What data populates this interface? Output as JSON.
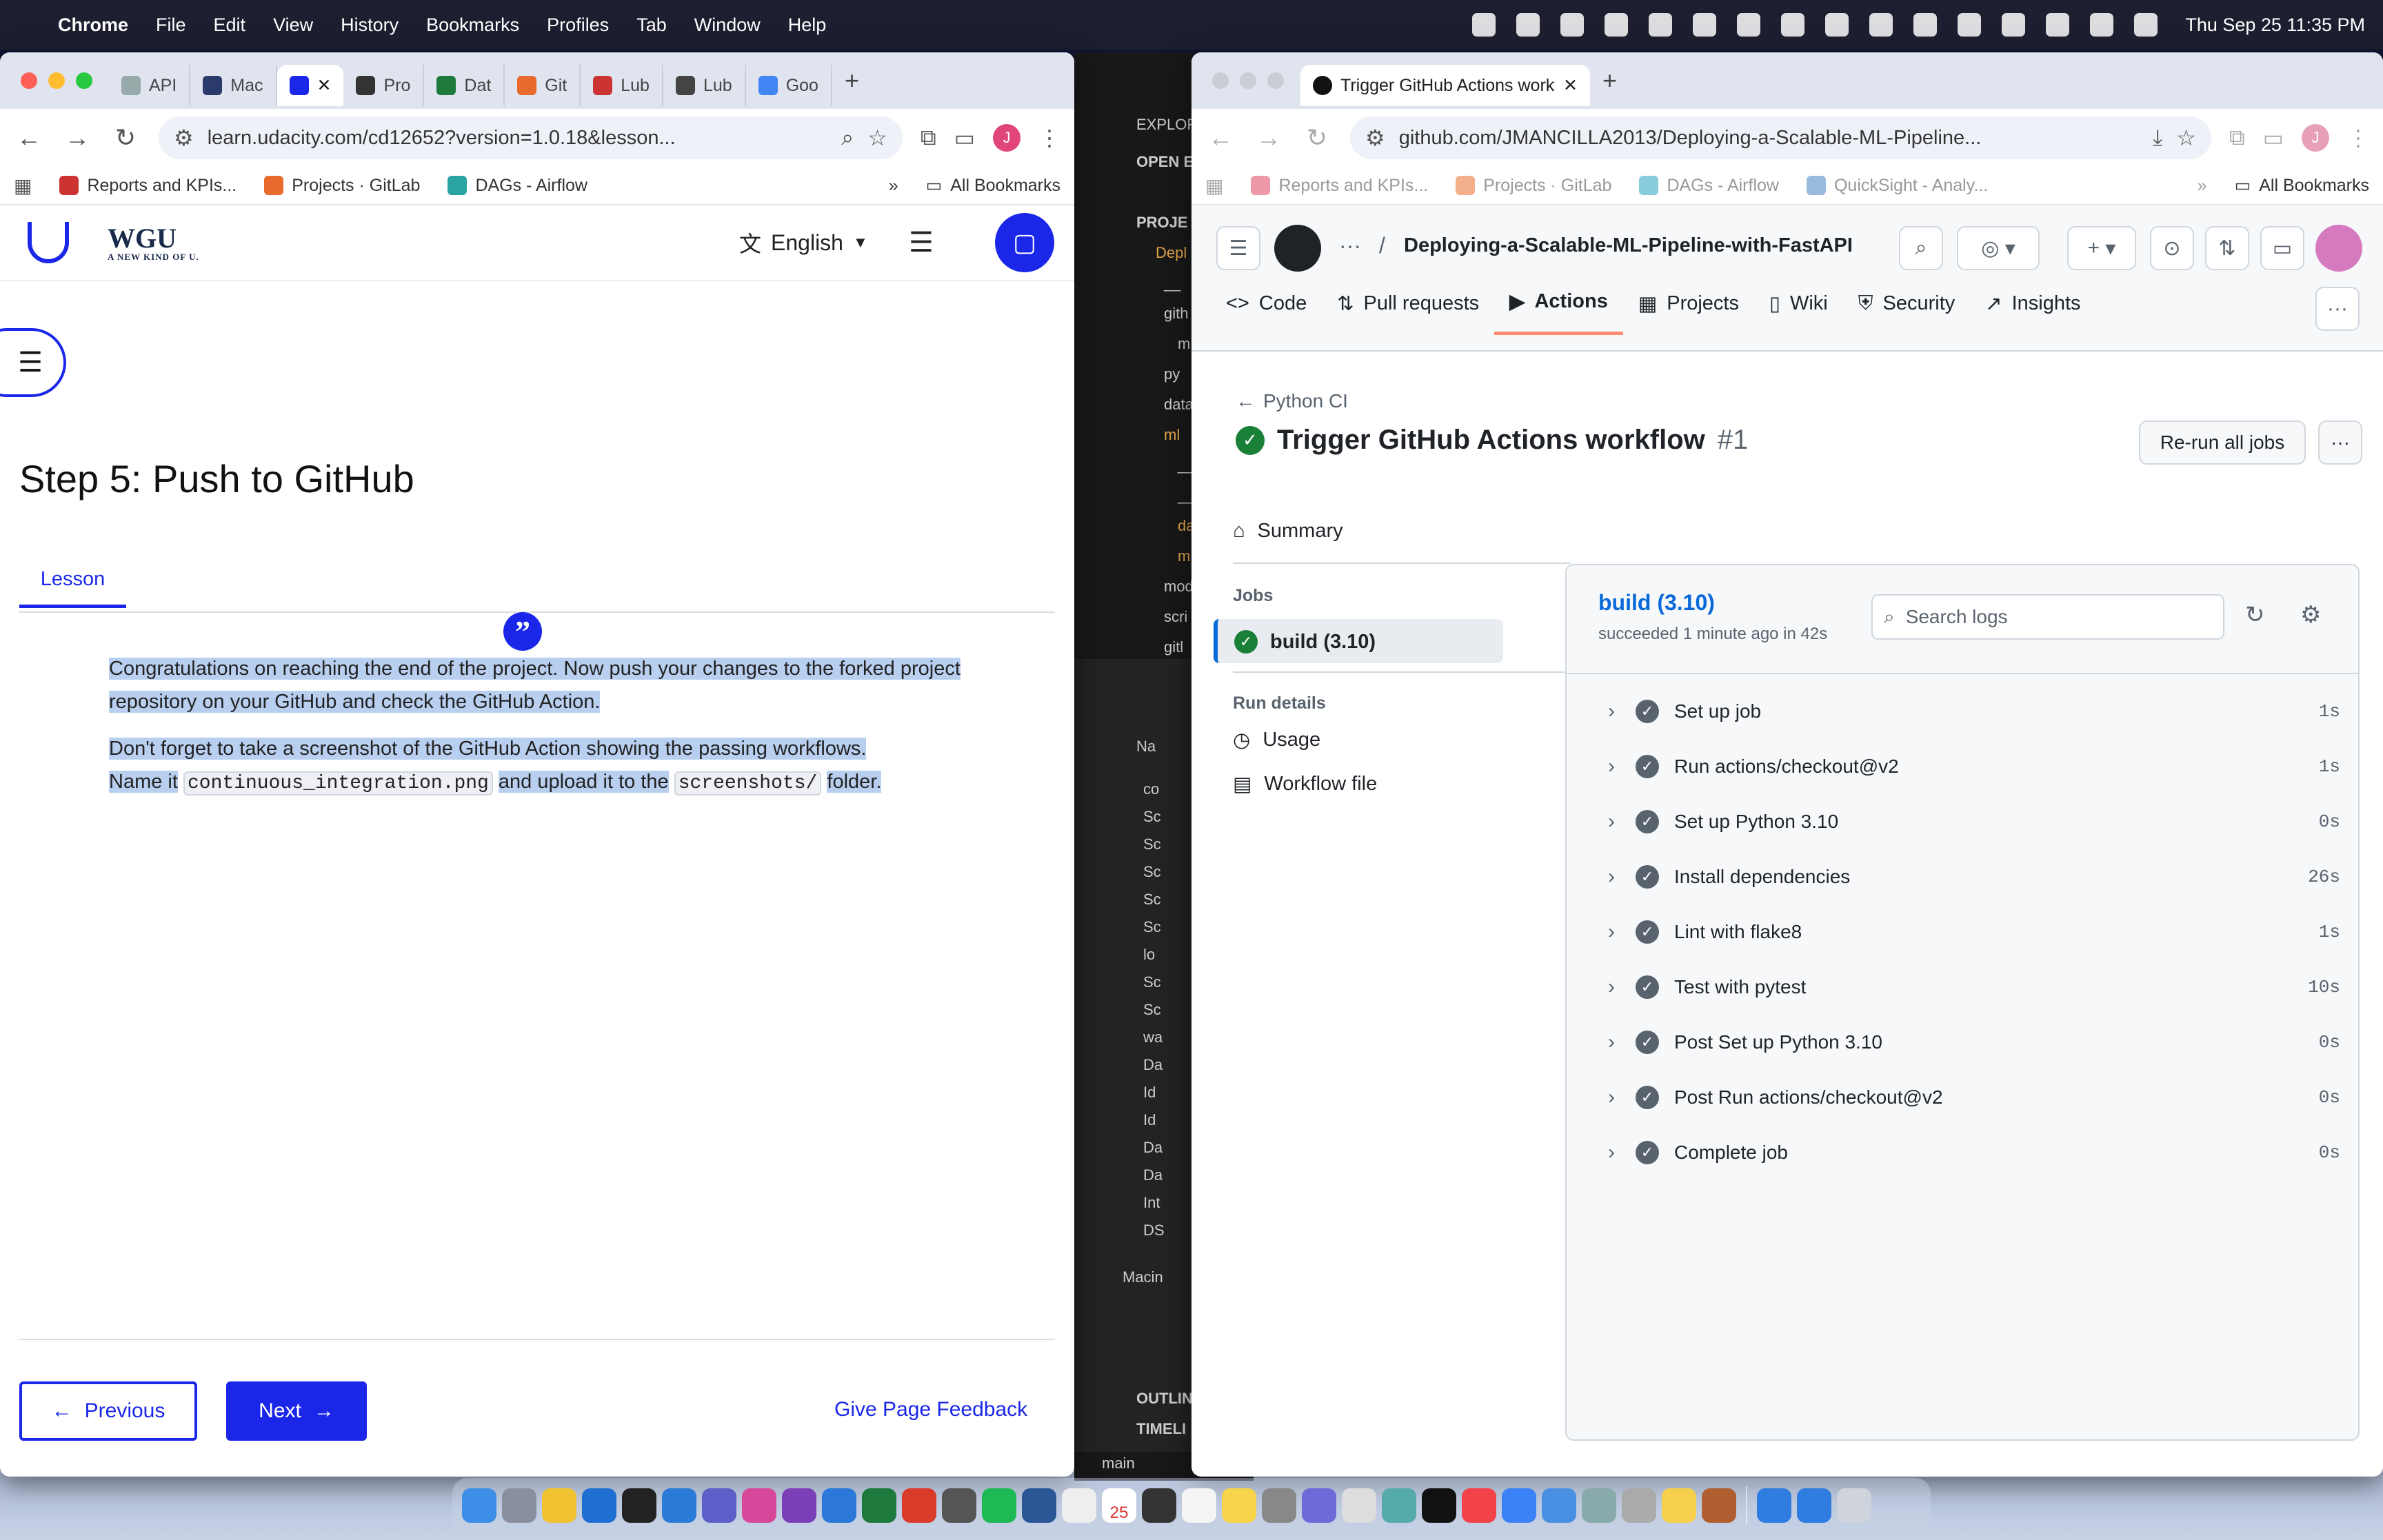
{
  "menubar": {
    "app": "Chrome",
    "items": [
      "File",
      "Edit",
      "View",
      "History",
      "Bookmarks",
      "Profiles",
      "Tab",
      "Window",
      "Help"
    ],
    "clock": "Thu Sep 25  11:35 PM"
  },
  "left_browser": {
    "tabs": [
      "API",
      "Mac",
      "",
      "Pro",
      "Dat",
      "Git",
      "Lub",
      "Lub",
      "Goo"
    ],
    "url": "learn.udacity.com/cd12652?version=1.0.18&lesson...",
    "avatar": "J",
    "bookmarks": [
      "Reports and KPIs...",
      "Projects · GitLab",
      "DAGs - Airflow"
    ],
    "all_bookmarks": "All Bookmarks",
    "page": {
      "brand": "WGU",
      "brand_tagline": "A NEW KIND OF U.",
      "language": "English",
      "step_title": "Step 5: Push to GitHub",
      "lesson_tab": "Lesson",
      "para1": "Congratulations on reaching the end of the project. Now push your changes to the forked project repository on your GitHub and check the GitHub Action.",
      "para2_a": "Don't forget to take a screenshot of the GitHub Action showing the passing workflows.",
      "para2_b": "Name it",
      "para2_code1": "continuous_integration.png",
      "para2_c": "and upload it to the",
      "para2_code2": "screenshots/",
      "para2_d": "folder.",
      "previous": "Previous",
      "next": "Next",
      "feedback": "Give Page Feedback"
    }
  },
  "vscode": {
    "explorer": "EXPLOR",
    "open_editors": "OPEN E",
    "project": "PROJE",
    "rows": [
      "Depl",
      "__",
      "gith",
      "m",
      "py",
      "data",
      "ml",
      "__",
      "__",
      "da",
      "m",
      "mod",
      "scri",
      "gitl"
    ],
    "files_header": "Na",
    "files": [
      "co",
      "Sc",
      "Sc",
      "Sc",
      "Sc",
      "Sc",
      "lo",
      "Sc",
      "Sc",
      "wa",
      "Da",
      "Id",
      "Id",
      "Da",
      "Da",
      "Int",
      "DS"
    ],
    "machine": "Macin",
    "outline": "OUTLIN",
    "timeline": "TIMELI",
    "branch": "main"
  },
  "right_browser": {
    "tab_title": "Trigger GitHub Actions workf",
    "url": "github.com/JMANCILLA2013/Deploying-a-Scalable-ML-Pipeline...",
    "avatar": "J",
    "bookmarks": [
      "Reports and KPIs...",
      "Projects · GitLab",
      "DAGs - Airflow",
      "QuickSight - Analy..."
    ],
    "all_bookmarks": "All Bookmarks",
    "github": {
      "breadcrumb_sep": "/",
      "repo": "Deploying-a-Scalable-ML-Pipeline-with-FastAPI",
      "nav": [
        "Code",
        "Pull requests",
        "Actions",
        "Projects",
        "Wiki",
        "Security",
        "Insights"
      ],
      "workflow_back": "Python CI",
      "run_title": "Trigger GitHub Actions workflow",
      "run_number": "#1",
      "rerun": "Re-run all jobs",
      "summary": "Summary",
      "jobs_label": "Jobs",
      "job_name": "build (3.10)",
      "run_details": "Run details",
      "usage": "Usage",
      "workflow_file": "Workflow file",
      "job_title": "build (3.10)",
      "job_status": "succeeded 1 minute ago in 42s",
      "search_placeholder": "Search logs",
      "steps": [
        {
          "name": "Set up job",
          "dur": "1s"
        },
        {
          "name": "Run actions/checkout@v2",
          "dur": "1s"
        },
        {
          "name": "Set up Python 3.10",
          "dur": "0s"
        },
        {
          "name": "Install dependencies",
          "dur": "26s"
        },
        {
          "name": "Lint with flake8",
          "dur": "1s"
        },
        {
          "name": "Test with pytest",
          "dur": "10s"
        },
        {
          "name": "Post Set up Python 3.10",
          "dur": "0s"
        },
        {
          "name": "Post Run actions/checkout@v2",
          "dur": "0s"
        },
        {
          "name": "Complete job",
          "dur": "0s"
        }
      ]
    }
  },
  "dock": {
    "calendar_day": "25"
  },
  "colors": {
    "udacity_blue": "#1a27e8",
    "github_green": "#1a7f37",
    "selection": "#b9cff0",
    "actions_underline": "#fd8c73"
  }
}
